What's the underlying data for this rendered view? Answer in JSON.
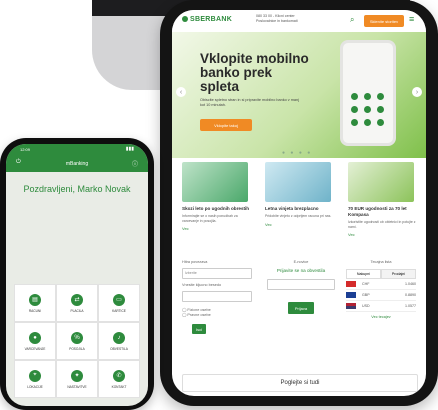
{
  "tablet": {
    "header": {
      "logo": "SBERBANK",
      "contact_line1": "080 33 00 - Klicni center",
      "contact_line2": "Poslovalnice in bankomati",
      "cta_button": "Sklenite storitev",
      "menu_icon": "menu-icon",
      "search_icon": "search-icon"
    },
    "hero": {
      "title": "Vklopite mobilno banko prek spleta",
      "subtitle": "Obiscite spletno stran in si pripravite mobilno banko v manj kot 10 minutah.",
      "button": "Vklopite takoj"
    },
    "promos": [
      {
        "title": "Skozi leto po ugodnih obrestih",
        "desc": "Informirajte se o nasih ponudbah za varcevanje in posojila.",
        "link": "Vec"
      },
      {
        "title": "Letna vinjeta brezplacno",
        "desc": "Pridobite vinjeto z odprtjem racuna pri nas.",
        "link": "Vec"
      },
      {
        "title": "70 EUR ugodnosti za 70 let Kompasa",
        "desc": "Izkoristite ugodnosti ob obletnici in potujte z nami.",
        "link": "Vec"
      }
    ],
    "widgets": {
      "contact_label": "Hitra povezava",
      "contact_select": "Izberite",
      "contact_input_label": "Vnesite kljucno besedo",
      "radio1": "Fizicne osebe",
      "radio2": "Pravne osebe",
      "contact_button": "Isci",
      "branch_title": "E-novice",
      "branch_subtitle": "Prijavite se na obvestila",
      "branch_button": "Prijava",
      "rates_title": "Tecajna lista",
      "rates_tab1": "Nakupni",
      "rates_tab2": "Prodajni",
      "rates": [
        {
          "code": "CHF",
          "value": "1.0460"
        },
        {
          "code": "GBP",
          "value": "0.8890"
        },
        {
          "code": "USD",
          "value": "1.0577"
        }
      ],
      "rates_link": "Vec tecajev"
    },
    "footer_button": "Poglejte si tudi"
  },
  "phone": {
    "status_time": "12:09",
    "header_title": "mBanking",
    "greeting": "Pozdravljeni, Marko Novak",
    "tiles": [
      {
        "label": "RACUNI",
        "icon": "wallet-icon"
      },
      {
        "label": "PLACILA",
        "icon": "transfer-icon"
      },
      {
        "label": "KARTICE",
        "icon": "card-icon"
      },
      {
        "label": "VARCEVANJE",
        "icon": "piggy-icon"
      },
      {
        "label": "POSOJILA",
        "icon": "loan-icon"
      },
      {
        "label": "OBVESTILA",
        "icon": "bell-icon"
      },
      {
        "label": "LOKACIJE",
        "icon": "location-icon"
      },
      {
        "label": "NASTAVITVE",
        "icon": "gear-icon"
      },
      {
        "label": "KONTAKT",
        "icon": "phone-icon"
      }
    ]
  },
  "colors": {
    "brand_green": "#2e8b3d",
    "accent_orange": "#f08a24"
  }
}
